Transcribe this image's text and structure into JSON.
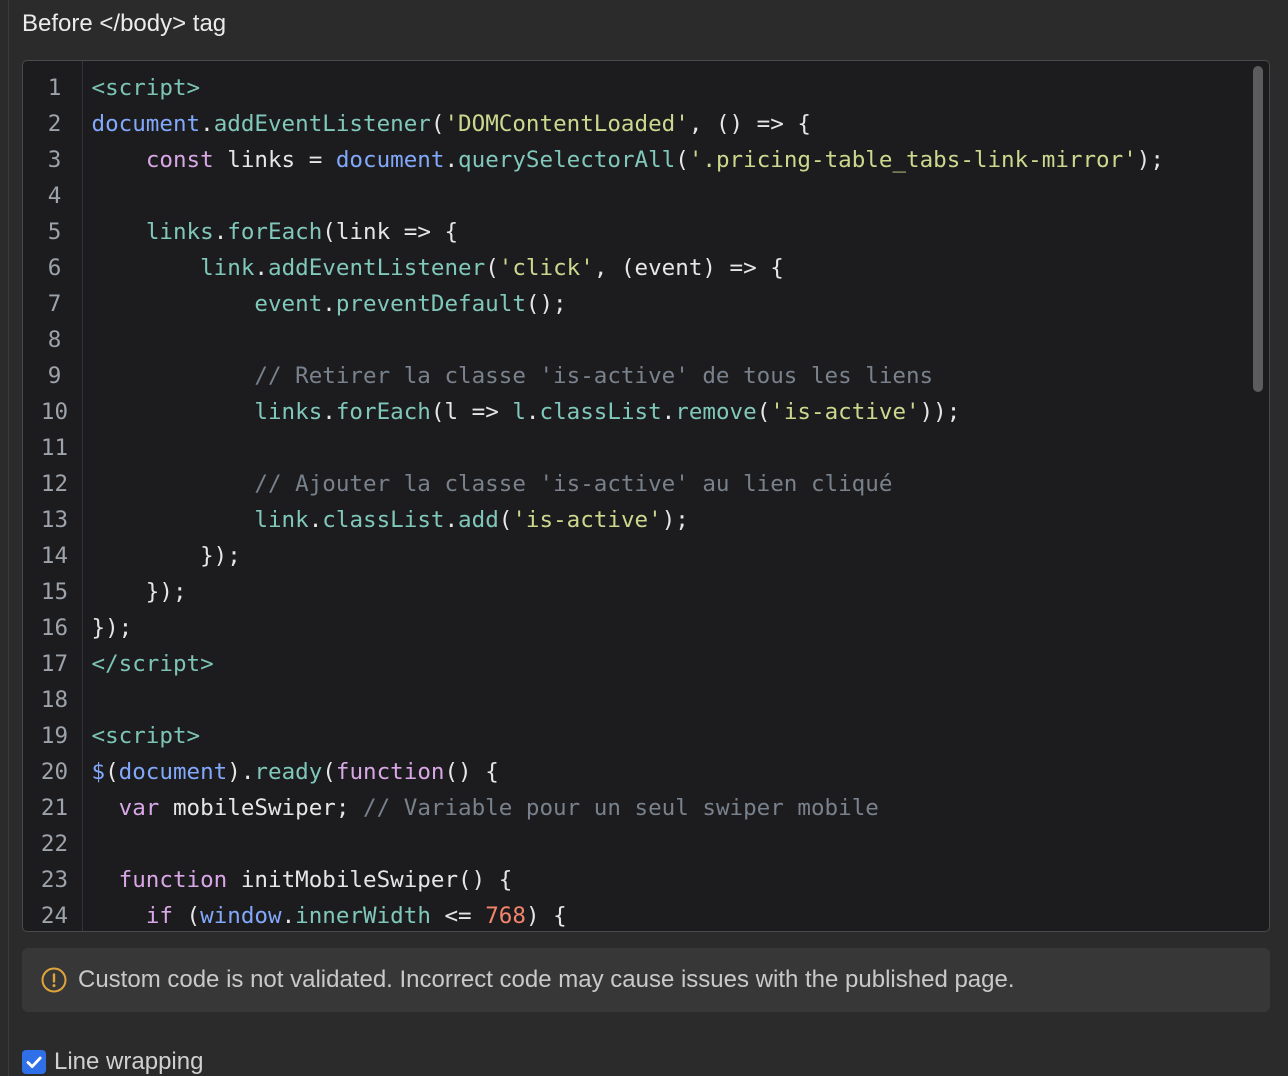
{
  "section": {
    "title": "Before </body> tag"
  },
  "editor": {
    "lines": [
      {
        "n": "1",
        "tokens": [
          {
            "tag": "<script>"
          }
        ]
      },
      {
        "n": "2",
        "tokens": [
          {
            "g": "document"
          },
          {
            "p": "."
          },
          {
            "m": "addEventListener"
          },
          {
            "p": "("
          },
          {
            "s": "'DOMContentLoaded'"
          },
          {
            "p": ", () => {"
          }
        ]
      },
      {
        "n": "3",
        "tokens": [
          {
            "p": "    "
          },
          {
            "kw": "const"
          },
          {
            "p": " links = "
          },
          {
            "g": "document"
          },
          {
            "p": "."
          },
          {
            "m": "querySelectorAll"
          },
          {
            "p": "("
          },
          {
            "s": "'.pricing-table_tabs-link-mirror'"
          },
          {
            "p": ");"
          }
        ]
      },
      {
        "n": "4",
        "tokens": []
      },
      {
        "n": "5",
        "tokens": [
          {
            "p": "    "
          },
          {
            "m": "links"
          },
          {
            "p": "."
          },
          {
            "m": "forEach"
          },
          {
            "p": "(link => {"
          }
        ]
      },
      {
        "n": "6",
        "tokens": [
          {
            "p": "        "
          },
          {
            "m": "link"
          },
          {
            "p": "."
          },
          {
            "m": "addEventListener"
          },
          {
            "p": "("
          },
          {
            "s": "'click'"
          },
          {
            "p": ", (event) => {"
          }
        ]
      },
      {
        "n": "7",
        "tokens": [
          {
            "p": "            "
          },
          {
            "m": "event"
          },
          {
            "p": "."
          },
          {
            "m": "preventDefault"
          },
          {
            "p": "();"
          }
        ]
      },
      {
        "n": "8",
        "tokens": []
      },
      {
        "n": "9",
        "tokens": [
          {
            "p": "            "
          },
          {
            "c": "// Retirer la classe 'is-active' de tous les liens"
          }
        ]
      },
      {
        "n": "10",
        "tokens": [
          {
            "p": "            "
          },
          {
            "m": "links"
          },
          {
            "p": "."
          },
          {
            "m": "forEach"
          },
          {
            "p": "(l => "
          },
          {
            "m": "l"
          },
          {
            "p": "."
          },
          {
            "m": "classList"
          },
          {
            "p": "."
          },
          {
            "m": "remove"
          },
          {
            "p": "("
          },
          {
            "s": "'is-active'"
          },
          {
            "p": "));"
          }
        ]
      },
      {
        "n": "11",
        "tokens": []
      },
      {
        "n": "12",
        "tokens": [
          {
            "p": "            "
          },
          {
            "c": "// Ajouter la classe 'is-active' au lien cliqué"
          }
        ]
      },
      {
        "n": "13",
        "tokens": [
          {
            "p": "            "
          },
          {
            "m": "link"
          },
          {
            "p": "."
          },
          {
            "m": "classList"
          },
          {
            "p": "."
          },
          {
            "m": "add"
          },
          {
            "p": "("
          },
          {
            "s": "'is-active'"
          },
          {
            "p": ");"
          }
        ]
      },
      {
        "n": "14",
        "tokens": [
          {
            "p": "        });"
          }
        ]
      },
      {
        "n": "15",
        "tokens": [
          {
            "p": "    });"
          }
        ]
      },
      {
        "n": "16",
        "tokens": [
          {
            "p": "});"
          }
        ]
      },
      {
        "n": "17",
        "tokens": [
          {
            "tag": "</script>"
          }
        ]
      },
      {
        "n": "18",
        "tokens": []
      },
      {
        "n": "19",
        "tokens": [
          {
            "tag": "<script>"
          }
        ]
      },
      {
        "n": "20",
        "tokens": [
          {
            "g": "$"
          },
          {
            "p": "("
          },
          {
            "g": "document"
          },
          {
            "p": ")."
          },
          {
            "m": "ready"
          },
          {
            "p": "("
          },
          {
            "kw": "function"
          },
          {
            "p": "() {"
          }
        ]
      },
      {
        "n": "21",
        "tokens": [
          {
            "p": "  "
          },
          {
            "kw": "var"
          },
          {
            "p": " mobileSwiper; "
          },
          {
            "c": "// Variable pour un seul swiper mobile"
          }
        ]
      },
      {
        "n": "22",
        "tokens": []
      },
      {
        "n": "23",
        "tokens": [
          {
            "p": "  "
          },
          {
            "kw": "function"
          },
          {
            "p": " initMobileSwiper() {"
          }
        ]
      },
      {
        "n": "24",
        "tokens": [
          {
            "p": "    "
          },
          {
            "kw": "if"
          },
          {
            "p": " ("
          },
          {
            "g": "window"
          },
          {
            "p": "."
          },
          {
            "m": "innerWidth"
          },
          {
            "p": " <= "
          },
          {
            "num": "768"
          },
          {
            "p": ") {"
          }
        ]
      }
    ]
  },
  "notice": {
    "icon": "alert-circle-icon",
    "text": "Custom code is not validated. Incorrect code may cause issues with the published page."
  },
  "options": {
    "line_wrapping": {
      "label": "Line wrapping",
      "checked": true,
      "icon": "checkmark-icon"
    }
  },
  "colors": {
    "page_background": "#2b2b2b",
    "panel_divider": "#3b3b3b",
    "title_text": "#ebebeb",
    "editor_background": "#1c1c1e",
    "editor_border": "#4a4a4c",
    "gutter_separator": "#333337",
    "line_number": "#9da3aa",
    "scrollbar_thumb": "#5c5c5e",
    "notice_background": "#373737",
    "notice_text": "#c9c9c9",
    "warning": "#e0a43c",
    "checkbox_accent": "#2f6fe8",
    "option_text": "#d0d0d0",
    "syntax": {
      "p": "#e6e6e6",
      "tag": "#7cc4b5",
      "kw": "#d9a7e6",
      "g": "#82a8fb",
      "m": "#80c8bb",
      "s": "#cdd88e",
      "c": "#78818c",
      "num": "#f3846c"
    }
  }
}
